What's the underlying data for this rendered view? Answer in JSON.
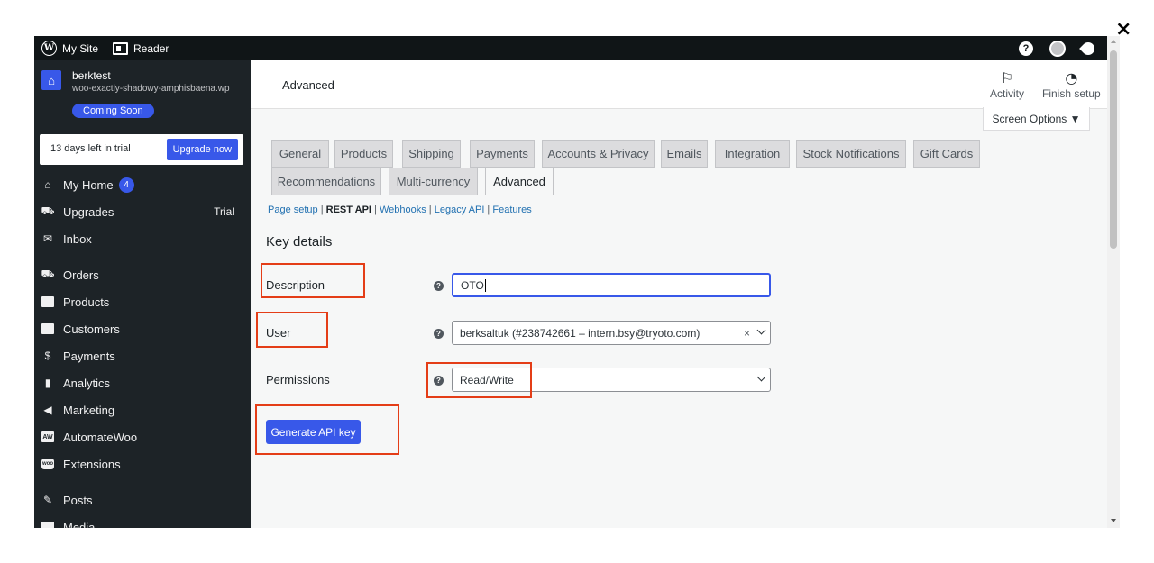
{
  "window": {
    "close_glyph": "×"
  },
  "topbar": {
    "my_site": "My Site",
    "reader": "Reader",
    "help_glyph": "?"
  },
  "site": {
    "icon_glyph": "⌂",
    "name": "berktest",
    "url": "woo-exactly-shadowy-amphisbaena.wp",
    "status": "Coming Soon"
  },
  "trial": {
    "text": "13 days left in trial",
    "upgrade": "Upgrade now"
  },
  "nav": {
    "my_home": "My Home",
    "my_home_badge": "4",
    "upgrades": "Upgrades",
    "upgrades_tag": "Trial",
    "inbox": "Inbox",
    "orders": "Orders",
    "products": "Products",
    "customers": "Customers",
    "payments": "Payments",
    "analytics": "Analytics",
    "marketing": "Marketing",
    "automatewoo": "AutomateWoo",
    "extensions": "Extensions",
    "posts": "Posts",
    "media": "Media"
  },
  "header": {
    "title": "Advanced",
    "activity": "Activity",
    "finish_setup": "Finish setup",
    "screen_options": "Screen Options ▼"
  },
  "tabs": {
    "general": "General",
    "products": "Products",
    "shipping": "Shipping",
    "payments": "Payments",
    "accounts": "Accounts & Privacy",
    "emails": "Emails",
    "integration": "Integration",
    "stock": "Stock Notifications",
    "gift_cards": "Gift Cards",
    "recommendations": "Recommendations",
    "multi_currency": "Multi-currency",
    "advanced": "Advanced"
  },
  "subnav": {
    "page_setup": "Page setup",
    "rest_api": "REST API",
    "webhooks": "Webhooks",
    "legacy_api": "Legacy API",
    "features": "Features",
    "sep": " | "
  },
  "form": {
    "title": "Key details",
    "description_label": "Description",
    "description_value": "OTO",
    "user_label": "User",
    "user_value": "berksaltuk (#238742661 – intern.bsy@tryoto.com)",
    "user_clear": "×",
    "permissions_label": "Permissions",
    "permissions_value": "Read/Write",
    "help_glyph": "?",
    "generate": "Generate API key"
  },
  "colors": {
    "accent": "#3858e9",
    "highlight": "#e43d17",
    "sidebar": "#1d2327"
  }
}
